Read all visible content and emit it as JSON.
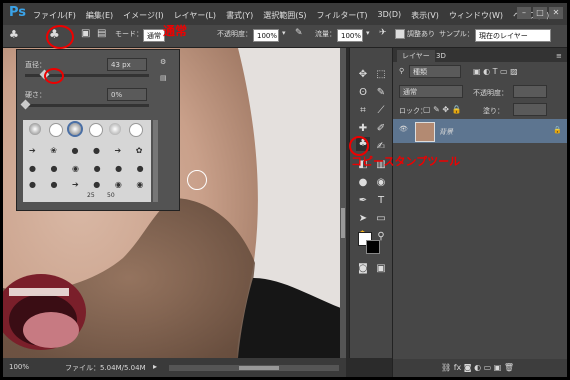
{
  "app": {
    "logo": "Ps"
  },
  "menu": [
    "ファイル(F)",
    "編集(E)",
    "イメージ(I)",
    "レイヤー(L)",
    "書式(Y)",
    "選択範囲(S)",
    "フィルター(T)",
    "3D(D)",
    "表示(V)",
    "ウィンドウ(W)",
    "ヘルプ(H)"
  ],
  "window_buttons": [
    "–",
    "□",
    "✕"
  ],
  "options": {
    "mode_label": "モード：",
    "mode_value": "通常",
    "opacity_label": "不透明度：",
    "opacity_value": "100%",
    "flow_label": "流量：",
    "flow_value": "100%",
    "aligned_label": "調整あり",
    "sample_label": "サンプル：",
    "sample_value": "現在のレイヤー"
  },
  "brush_popup": {
    "size_label": "直径：",
    "size_value": "43 px",
    "hardness_label": "硬さ：",
    "hardness_value": "0%",
    "size_level": 0.15,
    "hardness_level": 0.0,
    "numbers": [
      "25",
      "50"
    ]
  },
  "status": {
    "zoom": "100%",
    "file_info": "ファイル：5.04M/5.04M"
  },
  "layers_panel": {
    "tab_layers": "レイヤー",
    "tab_3d": "3D",
    "kind_label": "種類",
    "blend_mode": "通常",
    "opacity_label": "不透明度：",
    "lock_label": "ロック：",
    "fill_label": "塗り：",
    "layer_name": "背景"
  },
  "annotations": {
    "mode_note": "通常",
    "tool_note": "コピースタンプツール"
  },
  "colors": {
    "accent_red": "#e00000",
    "ps_blue": "#3aa3e8",
    "layer_selected": "#5d7590"
  }
}
